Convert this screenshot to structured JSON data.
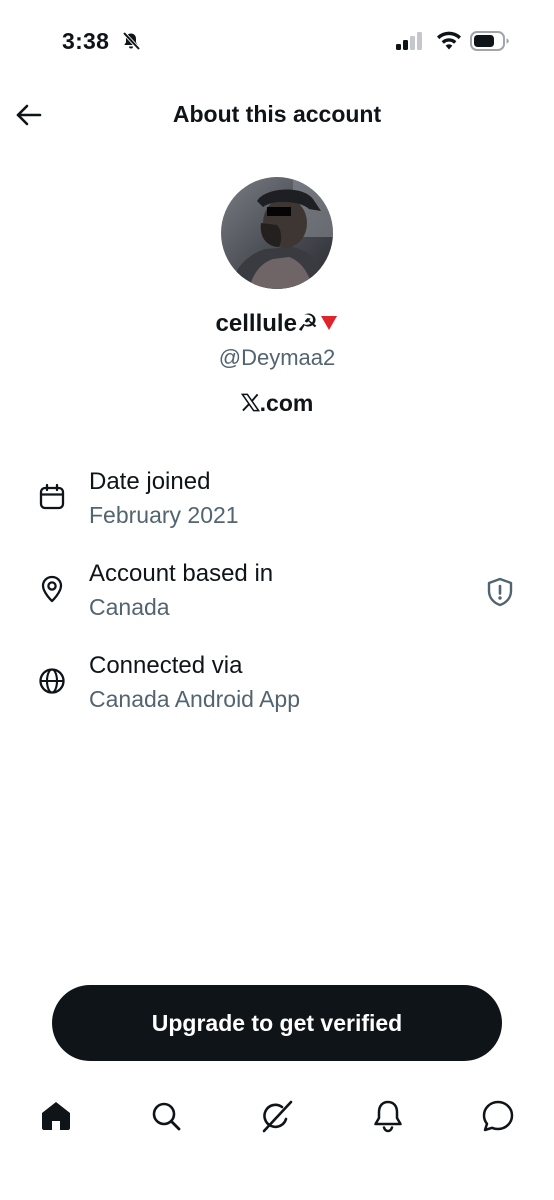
{
  "status_bar": {
    "time": "3:38"
  },
  "header": {
    "title": "About this account"
  },
  "profile": {
    "display_name": "celllule☭",
    "handle": "@Deymaa2",
    "site": ".com"
  },
  "info": [
    {
      "label": "Date joined",
      "value": "February 2021",
      "icon": "calendar-icon"
    },
    {
      "label": "Account based in",
      "value": "Canada",
      "icon": "location-pin-icon"
    },
    {
      "label": "Connected via",
      "value": "Canada Android App",
      "icon": "globe-icon"
    }
  ],
  "upgrade_button": {
    "label": "Upgrade to get verified"
  },
  "tab_bar": {
    "tabs": [
      "home-icon",
      "search-icon",
      "grok-icon",
      "notifications-icon",
      "messages-icon"
    ]
  },
  "colors": {
    "text_primary": "#0f1419",
    "text_secondary": "#536471",
    "button_bg": "#0f1419",
    "flag_red": "#e0242b"
  }
}
